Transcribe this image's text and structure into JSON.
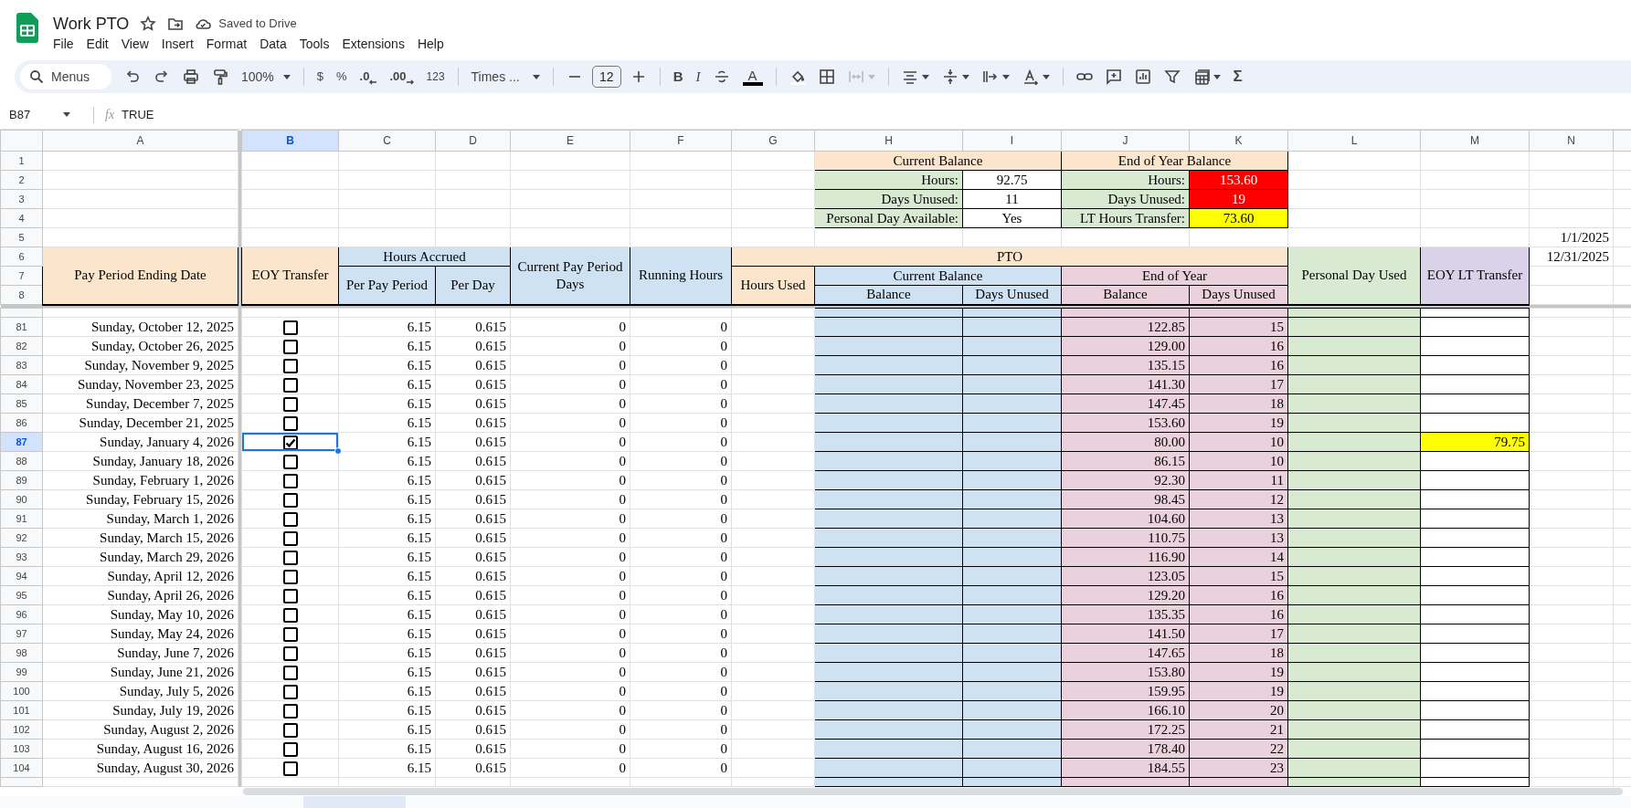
{
  "document": {
    "title": "Work PTO",
    "save_status": "Saved to Drive"
  },
  "menu": [
    "File",
    "Edit",
    "View",
    "Insert",
    "Format",
    "Data",
    "Tools",
    "Extensions",
    "Help"
  ],
  "toolbar": {
    "search_placeholder": "Menus",
    "zoom": "100%",
    "currency": "$",
    "percent": "%",
    "decrease_decimals": ".0",
    "increase_decimals": ".00",
    "number_format": "123",
    "font": "Times ...",
    "font_size": "12",
    "bold": "B",
    "italic": "I",
    "text_color": "A",
    "functions": "Σ"
  },
  "formula_bar": {
    "cell": "B87",
    "fx": "fx",
    "value": "TRUE"
  },
  "columns": [
    {
      "label": "A",
      "selected": false
    },
    {
      "label": "B",
      "selected": true
    },
    {
      "label": "C",
      "selected": false
    },
    {
      "label": "D",
      "selected": false
    },
    {
      "label": "E",
      "selected": false
    },
    {
      "label": "F",
      "selected": false
    },
    {
      "label": "G",
      "selected": false
    },
    {
      "label": "H",
      "selected": false
    },
    {
      "label": "I",
      "selected": false
    },
    {
      "label": "J",
      "selected": false
    },
    {
      "label": "K",
      "selected": false
    },
    {
      "label": "L",
      "selected": false
    },
    {
      "label": "M",
      "selected": false
    },
    {
      "label": "N",
      "selected": false
    }
  ],
  "top_row_numbers": [
    "1",
    "2",
    "3",
    "4",
    "5",
    "6",
    "7",
    "8"
  ],
  "summary": [
    {
      "title": "Current Balance",
      "rows": [
        {
          "label": "Hours:",
          "value": "92.75"
        },
        {
          "label": "Days Unused:",
          "value": "11"
        },
        {
          "label": "Personal Day Available:",
          "value": "Yes"
        }
      ]
    },
    {
      "title": "End of Year Balance",
      "rows": [
        {
          "label": "Hours:",
          "value": "153.60",
          "color": "#ff0000"
        },
        {
          "label": "Days Unused:",
          "value": "19",
          "color": "#ff0000"
        },
        {
          "label": "LT Hours Transfer:",
          "value": "73.60",
          "color": "#ffff00"
        }
      ]
    }
  ],
  "side_dates": [
    "1/1/2025",
    "12/31/2025"
  ],
  "headers": {
    "date": "Pay Period Ending Date",
    "eoy_transfer": "EOY Transfer",
    "hours_accrued": "Hours Accrued",
    "per_pay_period": "Per Pay Period",
    "per_day": "Per Day",
    "current_days": "Current Pay Period Days",
    "running_hours": "Running Hours",
    "pto": "PTO",
    "hours_used": "Hours Used",
    "current_balance": "Current Balance",
    "end_of_year": "End of Year",
    "balance": "Balance",
    "days_unused": "Days Unused",
    "eoy_balance": "Balance",
    "eoy_days_unused": "Days Unused",
    "personal_day_used": "Personal Day Used",
    "eoy_lt_transfer": "EOY LT Transfer"
  },
  "rows": [
    {
      "row": "81",
      "date": "Sunday, October 12, 2025",
      "eoy_transfer": false,
      "per_pay_period": "6.15",
      "per_day": "0.615",
      "days": "0",
      "running_hours": "0",
      "eoy_balance": "122.85",
      "eoy_days_unused": "15",
      "selected": false
    },
    {
      "row": "82",
      "date": "Sunday, October 26, 2025",
      "eoy_transfer": false,
      "per_pay_period": "6.15",
      "per_day": "0.615",
      "days": "0",
      "running_hours": "0",
      "eoy_balance": "129.00",
      "eoy_days_unused": "16",
      "selected": false
    },
    {
      "row": "83",
      "date": "Sunday, November 9, 2025",
      "eoy_transfer": false,
      "per_pay_period": "6.15",
      "per_day": "0.615",
      "days": "0",
      "running_hours": "0",
      "eoy_balance": "135.15",
      "eoy_days_unused": "16",
      "selected": false
    },
    {
      "row": "84",
      "date": "Sunday, November 23, 2025",
      "eoy_transfer": false,
      "per_pay_period": "6.15",
      "per_day": "0.615",
      "days": "0",
      "running_hours": "0",
      "eoy_balance": "141.30",
      "eoy_days_unused": "17",
      "selected": false
    },
    {
      "row": "85",
      "date": "Sunday, December 7, 2025",
      "eoy_transfer": false,
      "per_pay_period": "6.15",
      "per_day": "0.615",
      "days": "0",
      "running_hours": "0",
      "eoy_balance": "147.45",
      "eoy_days_unused": "18",
      "selected": false
    },
    {
      "row": "86",
      "date": "Sunday, December 21, 2025",
      "eoy_transfer": false,
      "per_pay_period": "6.15",
      "per_day": "0.615",
      "days": "0",
      "running_hours": "0",
      "eoy_balance": "153.60",
      "eoy_days_unused": "19",
      "selected": false
    },
    {
      "row": "87",
      "date": "Sunday, January 4, 2026",
      "eoy_transfer": true,
      "per_pay_period": "6.15",
      "per_day": "0.615",
      "days": "0",
      "running_hours": "0",
      "eoy_balance": "80.00",
      "eoy_days_unused": "10",
      "eoy_lt_transfer": {
        "text": "79.75",
        "color": "#ffff00"
      },
      "selected": true
    },
    {
      "row": "88",
      "date": "Sunday, January 18, 2026",
      "eoy_transfer": false,
      "per_pay_period": "6.15",
      "per_day": "0.615",
      "days": "0",
      "running_hours": "0",
      "eoy_balance": "86.15",
      "eoy_days_unused": "10",
      "selected": false
    },
    {
      "row": "89",
      "date": "Sunday, February 1, 2026",
      "eoy_transfer": false,
      "per_pay_period": "6.15",
      "per_day": "0.615",
      "days": "0",
      "running_hours": "0",
      "eoy_balance": "92.30",
      "eoy_days_unused": "11",
      "selected": false
    },
    {
      "row": "90",
      "date": "Sunday, February 15, 2026",
      "eoy_transfer": false,
      "per_pay_period": "6.15",
      "per_day": "0.615",
      "days": "0",
      "running_hours": "0",
      "eoy_balance": "98.45",
      "eoy_days_unused": "12",
      "selected": false
    },
    {
      "row": "91",
      "date": "Sunday, March 1, 2026",
      "eoy_transfer": false,
      "per_pay_period": "6.15",
      "per_day": "0.615",
      "days": "0",
      "running_hours": "0",
      "eoy_balance": "104.60",
      "eoy_days_unused": "13",
      "selected": false
    },
    {
      "row": "92",
      "date": "Sunday, March 15, 2026",
      "eoy_transfer": false,
      "per_pay_period": "6.15",
      "per_day": "0.615",
      "days": "0",
      "running_hours": "0",
      "eoy_balance": "110.75",
      "eoy_days_unused": "13",
      "selected": false
    },
    {
      "row": "93",
      "date": "Sunday, March 29, 2026",
      "eoy_transfer": false,
      "per_pay_period": "6.15",
      "per_day": "0.615",
      "days": "0",
      "running_hours": "0",
      "eoy_balance": "116.90",
      "eoy_days_unused": "14",
      "selected": false
    },
    {
      "row": "94",
      "date": "Sunday, April 12, 2026",
      "eoy_transfer": false,
      "per_pay_period": "6.15",
      "per_day": "0.615",
      "days": "0",
      "running_hours": "0",
      "eoy_balance": "123.05",
      "eoy_days_unused": "15",
      "selected": false
    },
    {
      "row": "95",
      "date": "Sunday, April 26, 2026",
      "eoy_transfer": false,
      "per_pay_period": "6.15",
      "per_day": "0.615",
      "days": "0",
      "running_hours": "0",
      "eoy_balance": "129.20",
      "eoy_days_unused": "16",
      "selected": false
    },
    {
      "row": "96",
      "date": "Sunday, May 10, 2026",
      "eoy_transfer": false,
      "per_pay_period": "6.15",
      "per_day": "0.615",
      "days": "0",
      "running_hours": "0",
      "eoy_balance": "135.35",
      "eoy_days_unused": "16",
      "selected": false
    },
    {
      "row": "97",
      "date": "Sunday, May 24, 2026",
      "eoy_transfer": false,
      "per_pay_period": "6.15",
      "per_day": "0.615",
      "days": "0",
      "running_hours": "0",
      "eoy_balance": "141.50",
      "eoy_days_unused": "17",
      "selected": false
    },
    {
      "row": "98",
      "date": "Sunday, June 7, 2026",
      "eoy_transfer": false,
      "per_pay_period": "6.15",
      "per_day": "0.615",
      "days": "0",
      "running_hours": "0",
      "eoy_balance": "147.65",
      "eoy_days_unused": "18",
      "selected": false
    },
    {
      "row": "99",
      "date": "Sunday, June 21, 2026",
      "eoy_transfer": false,
      "per_pay_period": "6.15",
      "per_day": "0.615",
      "days": "0",
      "running_hours": "0",
      "eoy_balance": "153.80",
      "eoy_days_unused": "19",
      "selected": false
    },
    {
      "row": "100",
      "date": "Sunday, July 5, 2026",
      "eoy_transfer": false,
      "per_pay_period": "6.15",
      "per_day": "0.615",
      "days": "0",
      "running_hours": "0",
      "eoy_balance": "159.95",
      "eoy_days_unused": "19",
      "selected": false
    },
    {
      "row": "101",
      "date": "Sunday, July 19, 2026",
      "eoy_transfer": false,
      "per_pay_period": "6.15",
      "per_day": "0.615",
      "days": "0",
      "running_hours": "0",
      "eoy_balance": "166.10",
      "eoy_days_unused": "20",
      "selected": false
    },
    {
      "row": "102",
      "date": "Sunday, August 2, 2026",
      "eoy_transfer": false,
      "per_pay_period": "6.15",
      "per_day": "0.615",
      "days": "0",
      "running_hours": "0",
      "eoy_balance": "172.25",
      "eoy_days_unused": "21",
      "selected": false
    },
    {
      "row": "103",
      "date": "Sunday, August 16, 2026",
      "eoy_transfer": false,
      "per_pay_period": "6.15",
      "per_day": "0.615",
      "days": "0",
      "running_hours": "0",
      "eoy_balance": "178.40",
      "eoy_days_unused": "22",
      "selected": false
    },
    {
      "row": "104",
      "date": "Sunday, August 30, 2026",
      "eoy_transfer": false,
      "per_pay_period": "6.15",
      "per_day": "0.615",
      "days": "0",
      "running_hours": "0",
      "eoy_balance": "184.55",
      "eoy_days_unused": "23",
      "selected": false
    }
  ]
}
